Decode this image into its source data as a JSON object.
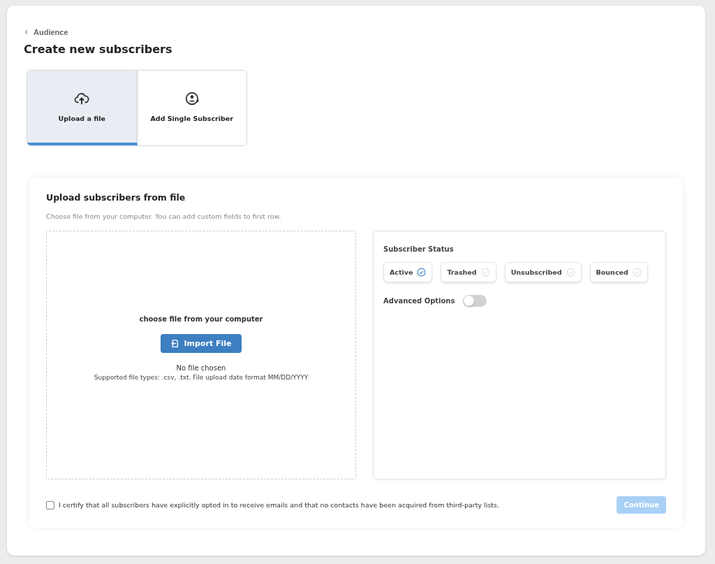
{
  "breadcrumb": {
    "label": "Audience"
  },
  "title": "Create new subscribers",
  "tabs": [
    {
      "label": "Upload a file",
      "selected": true
    },
    {
      "label": "Add Single Subscriber",
      "selected": false
    }
  ],
  "upload_section": {
    "heading": "Upload subscribers from file",
    "subtitle": "Choose file from your computer. You can add custom fields to first row.",
    "dropzone": {
      "prompt": "choose file from your computer",
      "button": "Import File",
      "file_status": "No file chosen",
      "hint": "Supported file types: .csv, .txt. File upload date format MM/DD/YYYY"
    },
    "options": {
      "status_label": "Subscriber Status",
      "statuses": [
        {
          "label": "Active",
          "selected": true
        },
        {
          "label": "Trashed",
          "selected": false
        },
        {
          "label": "Unsubscribed",
          "selected": false
        },
        {
          "label": "Bounced",
          "selected": false
        }
      ],
      "advanced": {
        "label": "Advanced Options",
        "on": false
      }
    }
  },
  "certify": {
    "label": "I certify that all subscribers have explicitly opted in to receive emails and that no contacts have been acquired from third-party lists.",
    "checked": false
  },
  "continue_button": {
    "label": "Continue",
    "disabled": true
  }
}
